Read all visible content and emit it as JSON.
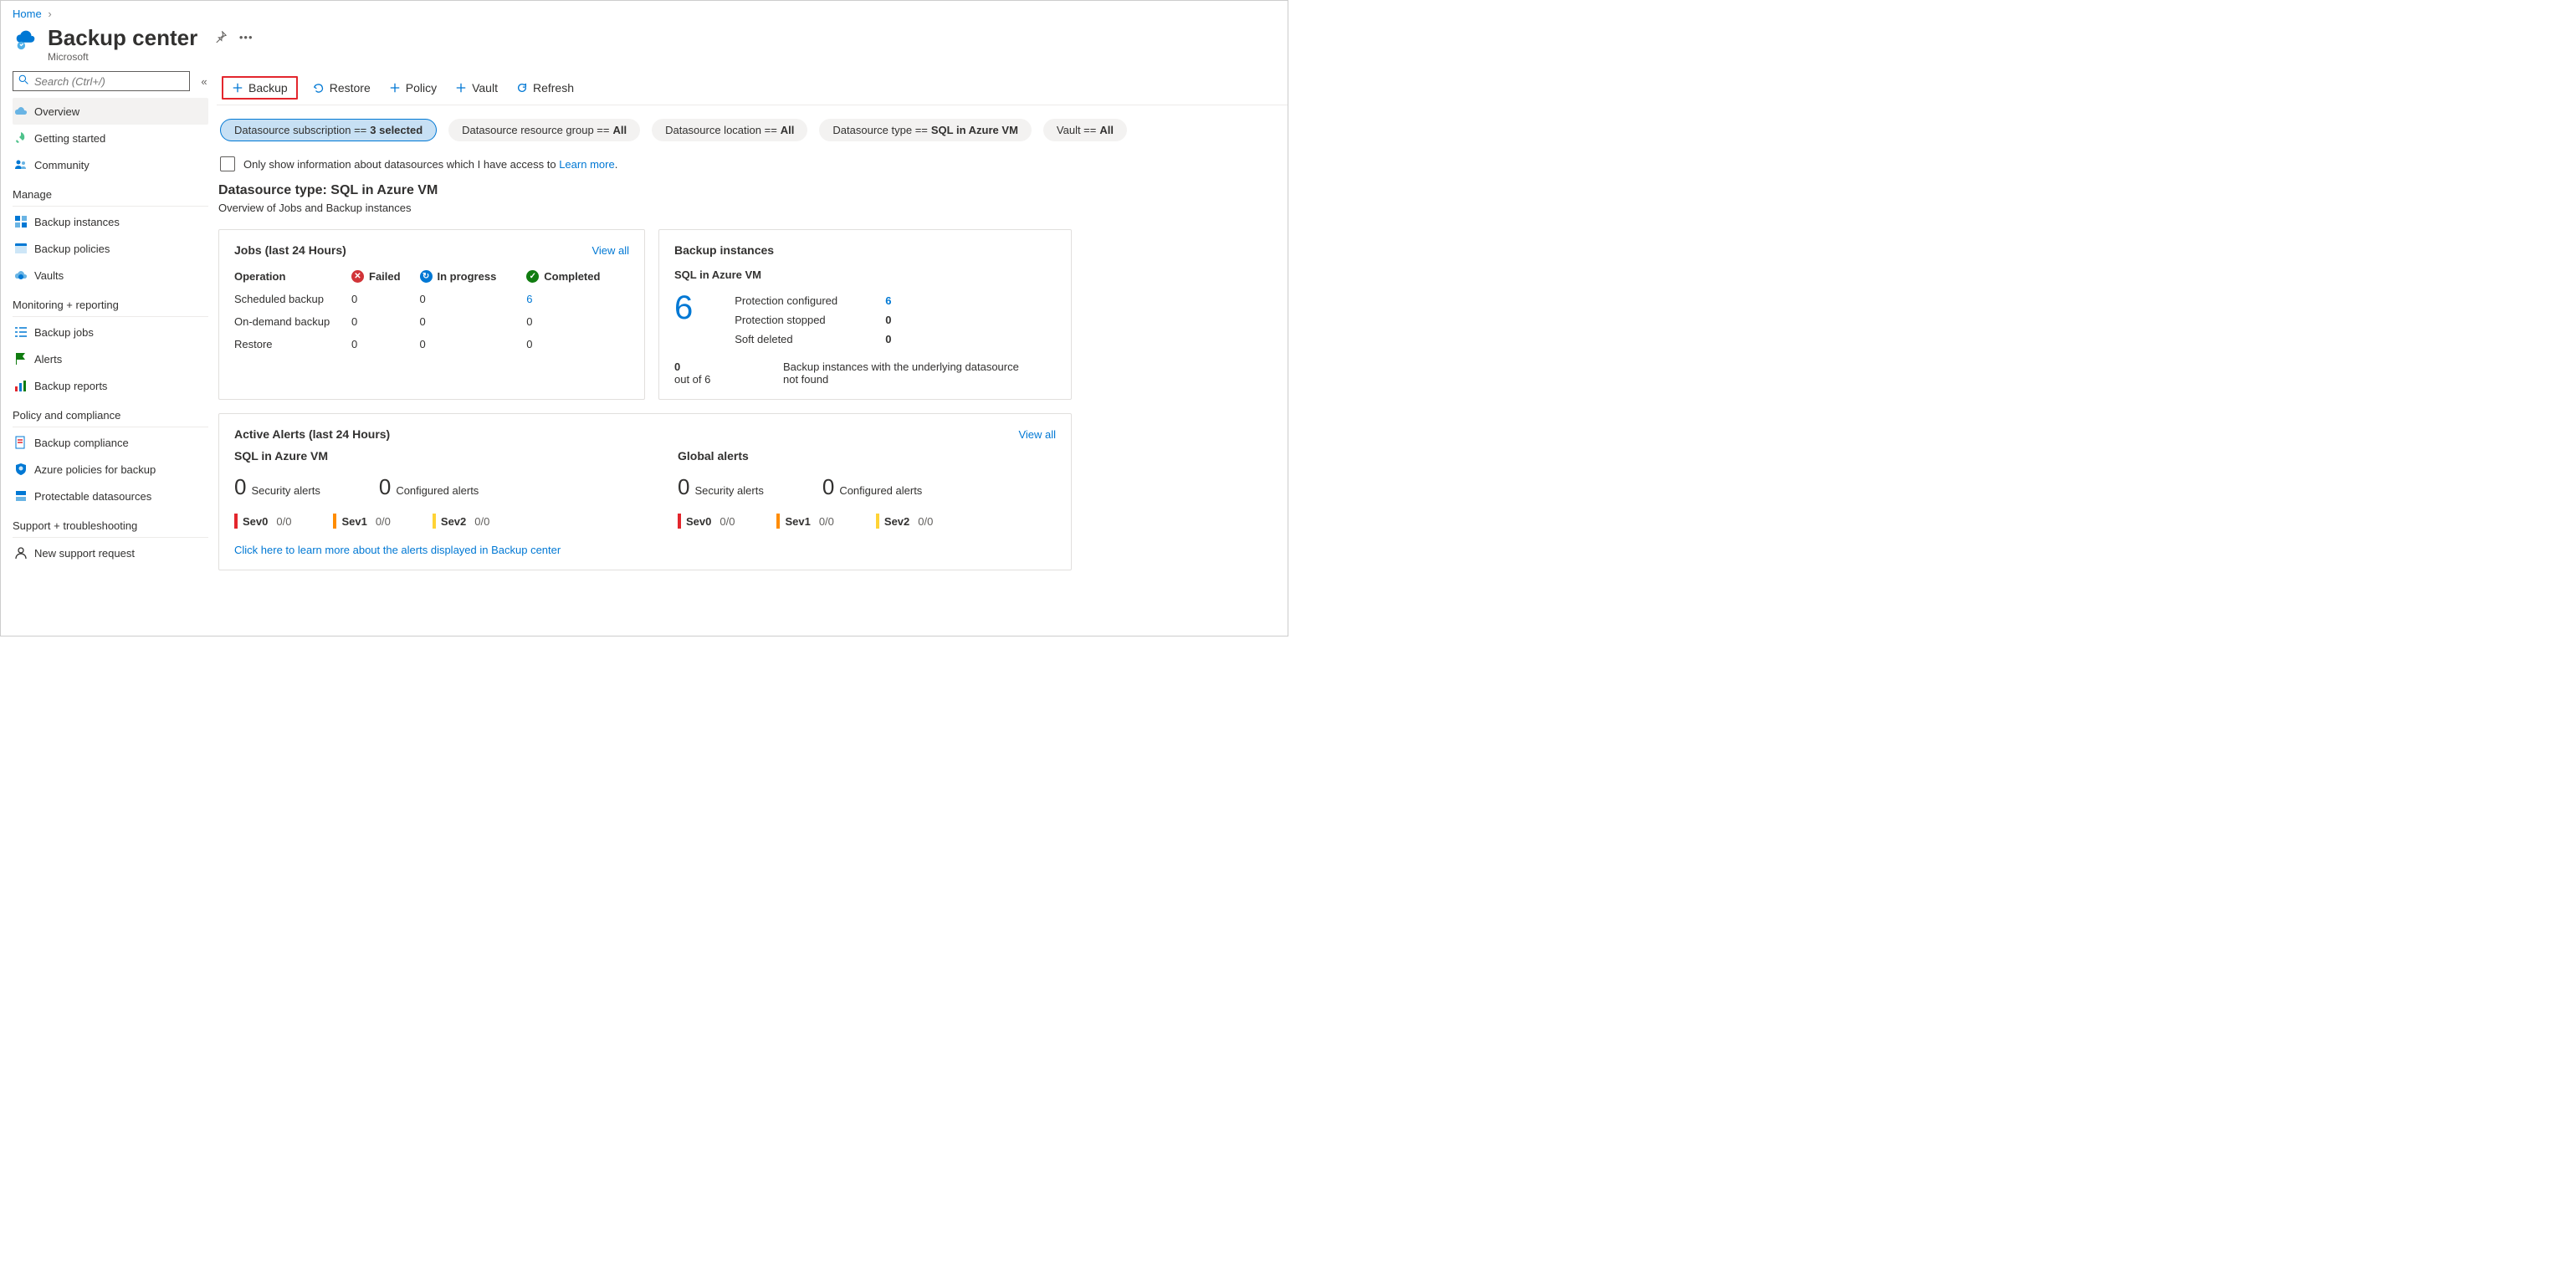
{
  "breadcrumb": {
    "home": "Home"
  },
  "header": {
    "title": "Backup center",
    "subtitle": "Microsoft"
  },
  "search": {
    "placeholder": "Search (Ctrl+/)"
  },
  "toolbar": {
    "backup": "Backup",
    "restore": "Restore",
    "policy": "Policy",
    "vault": "Vault",
    "refresh": "Refresh"
  },
  "nav": {
    "overview": "Overview",
    "getting_started": "Getting started",
    "community": "Community",
    "groups": {
      "manage": "Manage",
      "monitoring": "Monitoring + reporting",
      "policy": "Policy and compliance",
      "support": "Support + troubleshooting"
    },
    "backup_instances": "Backup instances",
    "backup_policies": "Backup policies",
    "vaults": "Vaults",
    "backup_jobs": "Backup jobs",
    "alerts": "Alerts",
    "backup_reports": "Backup reports",
    "backup_compliance": "Backup compliance",
    "azure_policies": "Azure policies for backup",
    "protectable": "Protectable datasources",
    "new_support": "New support request"
  },
  "filters": {
    "subscription": {
      "label": "Datasource subscription == ",
      "value": "3 selected"
    },
    "resource_group": {
      "label": "Datasource resource group == ",
      "value": "All"
    },
    "location": {
      "label": "Datasource location == ",
      "value": "All"
    },
    "type": {
      "label": "Datasource type == ",
      "value": "SQL in Azure VM"
    },
    "vault": {
      "label": "Vault == ",
      "value": "All"
    }
  },
  "access_checkbox": {
    "text": "Only show information about datasources which I have access to ",
    "learn_more": "Learn more"
  },
  "section": {
    "title": "Datasource type: SQL in Azure VM",
    "subtitle": "Overview of Jobs and Backup instances"
  },
  "jobs_card": {
    "title": "Jobs (last 24 Hours)",
    "view_all": "View all",
    "headers": {
      "operation": "Operation",
      "failed": "Failed",
      "in_progress": "In progress",
      "completed": "Completed"
    },
    "rows": {
      "scheduled": {
        "label": "Scheduled backup",
        "failed": "0",
        "in_progress": "0",
        "completed": "6"
      },
      "ondemand": {
        "label": "On-demand backup",
        "failed": "0",
        "in_progress": "0",
        "completed": "0"
      },
      "restore": {
        "label": "Restore",
        "failed": "0",
        "in_progress": "0",
        "completed": "0"
      }
    }
  },
  "instances_card": {
    "title": "Backup instances",
    "subtitle": "SQL in Azure VM",
    "big": "6",
    "kv": {
      "configured": {
        "k": "Protection configured",
        "v": "6"
      },
      "stopped": {
        "k": "Protection stopped",
        "v": "0"
      },
      "soft": {
        "k": "Soft deleted",
        "v": "0"
      }
    },
    "footer": {
      "left_num": "0",
      "left_sub": "out of 6",
      "right": "Backup instances with the underlying datasource not found"
    }
  },
  "alerts_card": {
    "title": "Active Alerts (last 24 Hours)",
    "view_all": "View all",
    "link": "Click here to learn more about the alerts displayed in Backup center",
    "col1": {
      "title": "SQL in Azure VM",
      "security": {
        "n": "0",
        "label": "Security alerts"
      },
      "configured": {
        "n": "0",
        "label": "Configured alerts"
      },
      "sev0": {
        "label": "Sev0",
        "frac": "0/0"
      },
      "sev1": {
        "label": "Sev1",
        "frac": "0/0"
      },
      "sev2": {
        "label": "Sev2",
        "frac": "0/0"
      }
    },
    "col2": {
      "title": "Global alerts",
      "security": {
        "n": "0",
        "label": "Security alerts"
      },
      "configured": {
        "n": "0",
        "label": "Configured alerts"
      },
      "sev0": {
        "label": "Sev0",
        "frac": "0/0"
      },
      "sev1": {
        "label": "Sev1",
        "frac": "0/0"
      },
      "sev2": {
        "label": "Sev2",
        "frac": "0/0"
      }
    }
  }
}
